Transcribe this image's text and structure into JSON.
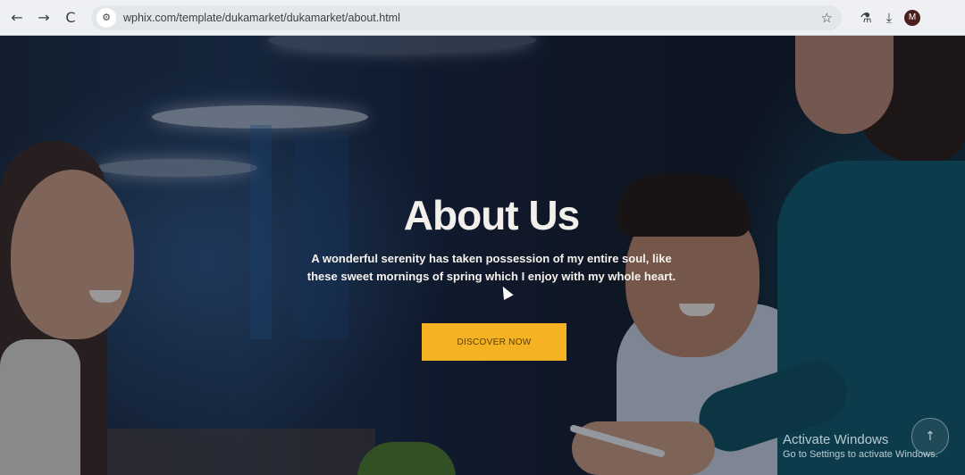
{
  "browser": {
    "back_icon": "←",
    "forward_icon": "→",
    "reload_icon": "C",
    "site_info_icon": "⚙",
    "url": "wphix.com/template/dukamarket/dukamarket/about.html",
    "bookmark_icon": "☆",
    "labs_icon": "⚗",
    "download_icon": "⤓",
    "profile_initial": "M"
  },
  "hero": {
    "title": "About Us",
    "text": "A wonderful serenity has taken possession of my entire soul, like these sweet mornings of spring which I enjoy with my whole heart.",
    "button_label": "DISCOVER NOW",
    "button_color": "#f5b324"
  },
  "windows_watermark": {
    "line1": "Activate Windows",
    "line2": "Go to Settings to activate Windows."
  },
  "scroll_top_icon": "↑"
}
